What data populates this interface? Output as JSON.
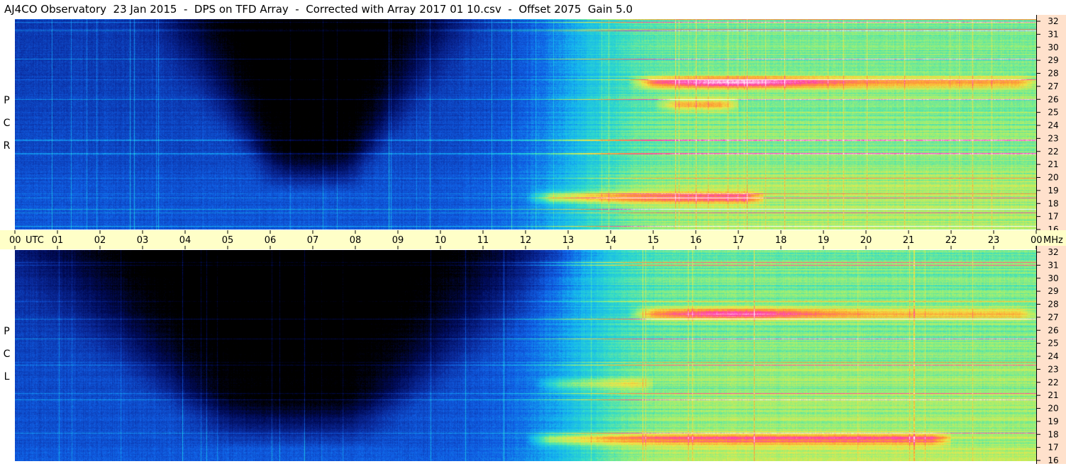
{
  "title": "AJ4CO Observatory  23 Jan 2015  -  DPS on TFD Array  -  Corrected with Array 2017 01 10.csv  -  Offset 2075  Gain 5.0",
  "chart_data": [
    {
      "type": "heatmap",
      "name": "R C P",
      "polarization": [
        "R",
        "C",
        "P"
      ],
      "x_axis": {
        "unit_label": "UTC",
        "range": [
          0,
          24
        ],
        "ticks": [
          "00",
          "01",
          "02",
          "03",
          "04",
          "05",
          "06",
          "07",
          "08",
          "09",
          "10",
          "11",
          "12",
          "13",
          "14",
          "15",
          "16",
          "17",
          "18",
          "19",
          "20",
          "21",
          "22",
          "23",
          "00"
        ]
      },
      "y_axis": {
        "unit_label": "MHz",
        "range": [
          16,
          32
        ],
        "ticks": [
          16,
          17,
          18,
          19,
          20,
          21,
          22,
          23,
          24,
          25,
          26,
          27,
          28,
          29,
          30,
          31,
          32
        ]
      },
      "colormap": [
        "#000000",
        "#000a55",
        "#0a2a9c",
        "#1060e6",
        "#14b4f0",
        "#32dcc8",
        "#96f078",
        "#f0e646",
        "#ff9632",
        "#ff3cb4",
        "#ffffff"
      ],
      "features": [
        {
          "kind": "band",
          "freq_mhz": 27.2,
          "utc_range": [
            14.4,
            24
          ],
          "peak_utc": 16.9,
          "level": 0.95
        },
        {
          "kind": "band",
          "freq_mhz": 18.4,
          "utc_range": [
            12.0,
            17.6
          ],
          "level": 0.8
        },
        {
          "kind": "band",
          "freq_mhz": 25.5,
          "utc_range": [
            15.0,
            17.0
          ],
          "level": 0.75
        },
        {
          "kind": "dark_region",
          "utc_center": 7.0,
          "freq_mhz_range": [
            21,
            32
          ],
          "utc_range": [
            4.5,
            11.0
          ]
        }
      ]
    },
    {
      "type": "heatmap",
      "name": "L C P",
      "polarization": [
        "L",
        "C",
        "P"
      ],
      "x_axis": {
        "unit_label": "UTC",
        "range": [
          0,
          24
        ],
        "ticks": [
          "00",
          "01",
          "02",
          "03",
          "04",
          "05",
          "06",
          "07",
          "08",
          "09",
          "10",
          "11",
          "12",
          "13",
          "14",
          "15",
          "16",
          "17",
          "18",
          "19",
          "20",
          "21",
          "22",
          "23",
          "00"
        ]
      },
      "y_axis": {
        "unit_label": "MHz",
        "range": [
          16,
          32
        ],
        "ticks": [
          16,
          17,
          18,
          19,
          20,
          21,
          22,
          23,
          24,
          25,
          26,
          27,
          28,
          29,
          30,
          31,
          32
        ]
      },
      "colormap": [
        "#000000",
        "#000a55",
        "#0a2a9c",
        "#1060e6",
        "#14b4f0",
        "#32dcc8",
        "#96f078",
        "#f0e646",
        "#ff9632",
        "#ff3cb4",
        "#ffffff"
      ],
      "features": [
        {
          "kind": "band",
          "freq_mhz": 27.2,
          "utc_range": [
            14.4,
            24
          ],
          "peak_utc": 16.9,
          "level": 0.92
        },
        {
          "kind": "band",
          "freq_mhz": 17.6,
          "utc_range": [
            12.0,
            22.0
          ],
          "level": 0.8
        },
        {
          "kind": "band",
          "freq_mhz": 21.8,
          "utc_range": [
            12.2,
            15.0
          ],
          "level": 0.7
        },
        {
          "kind": "dark_region",
          "utc_center": 6.5,
          "freq_mhz_range": [
            19.5,
            32
          ],
          "utc_range": [
            0.0,
            12.0
          ]
        }
      ]
    }
  ]
}
